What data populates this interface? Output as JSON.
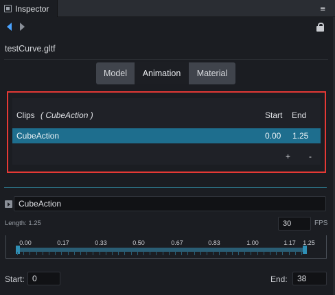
{
  "window": {
    "tab_title": "Inspector",
    "menu_glyph": "≡"
  },
  "asset": {
    "filename": "testCurve.gltf"
  },
  "tabs": [
    {
      "label": "Model",
      "active": false
    },
    {
      "label": "Animation",
      "active": true
    },
    {
      "label": "Material",
      "active": false
    }
  ],
  "clips": {
    "header_label": "Clips",
    "header_current": "( CubeAction )",
    "col_start": "Start",
    "col_end": "End",
    "rows": [
      {
        "name": "CubeAction",
        "start": "0.00",
        "end": "1.25",
        "selected": true
      }
    ],
    "add_label": "+",
    "remove_label": "-"
  },
  "editor": {
    "clip_name": "CubeAction",
    "length_text": "Length: 1.25",
    "fps_value": "30",
    "fps_label": "FPS",
    "ruler_labels": [
      "0.00",
      "0.17",
      "0.33",
      "0.50",
      "0.67",
      "0.83",
      "1.00",
      "1.17",
      "1.25"
    ],
    "start_label": "Start:",
    "start_value": "0",
    "end_label": "End:",
    "end_value": "38"
  },
  "colors": {
    "accent": "#1e6e8e",
    "highlight_border": "#e53935",
    "background": "#1b1d22"
  },
  "icons": [
    "panel-icon",
    "menu-icon",
    "back-arrow-icon",
    "forward-arrow-icon",
    "lock-icon",
    "play-icon"
  ]
}
